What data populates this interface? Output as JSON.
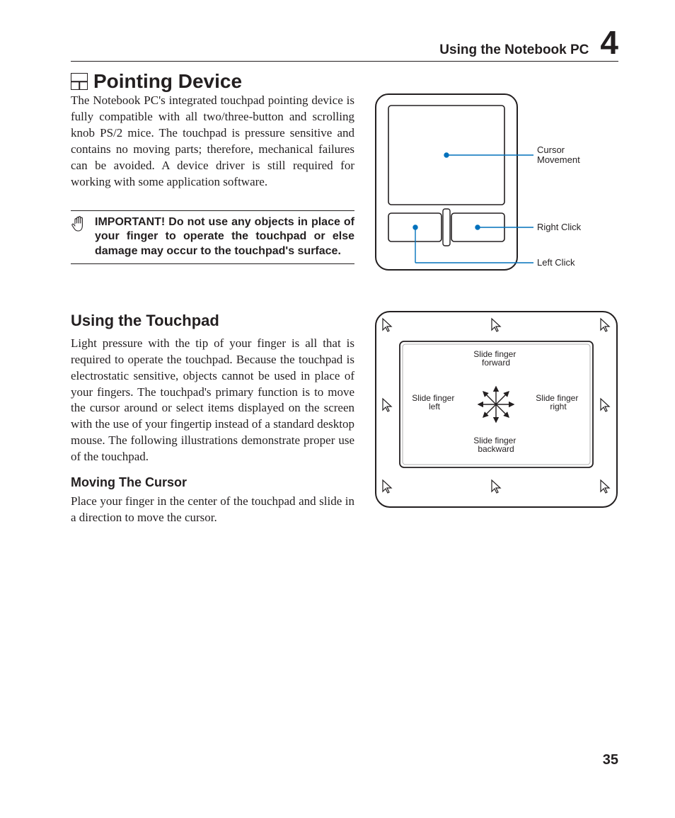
{
  "header": {
    "title": "Using the Notebook PC",
    "chapter_number": "4"
  },
  "page_number": "35",
  "section1": {
    "heading": "Pointing Device",
    "paragraph": "The Notebook PC's integrated touchpad pointing device is fully compatible with all two/three-button and scrolling knob PS/2 mice. The touchpad is pressure sensitive and contains no moving parts; therefore, mechanical failures can be avoided. A device driver is still required for working with some application software.",
    "important": "IMPORTANT! Do not use any objects in place of your finger to operate the touchpad or else damage may occur to the touchpad's surface.",
    "figure_labels": {
      "cursor_movement": "Cursor Movement",
      "right_click": "Right Click",
      "left_click": "Left Click"
    }
  },
  "section2": {
    "heading": "Using the Touchpad",
    "paragraph": "Light pressure with the tip of your finger is all that is required to operate the touchpad. Because the touchpad is electrostatic sensitive, objects cannot be used in place of your fingers. The touchpad's primary function is to move the cursor around or select items displayed on the screen with the use of your fingertip instead of a standard desktop mouse. The following illustrations demonstrate proper use of the touchpad.",
    "sub_heading": "Moving The Cursor",
    "sub_paragraph": "Place your finger in the center of the touchpad and slide in a direction to move the cursor.",
    "figure_labels": {
      "forward": "Slide finger forward",
      "backward": "Slide finger backward",
      "left": "Slide finger left",
      "right": "Slide finger right"
    }
  }
}
